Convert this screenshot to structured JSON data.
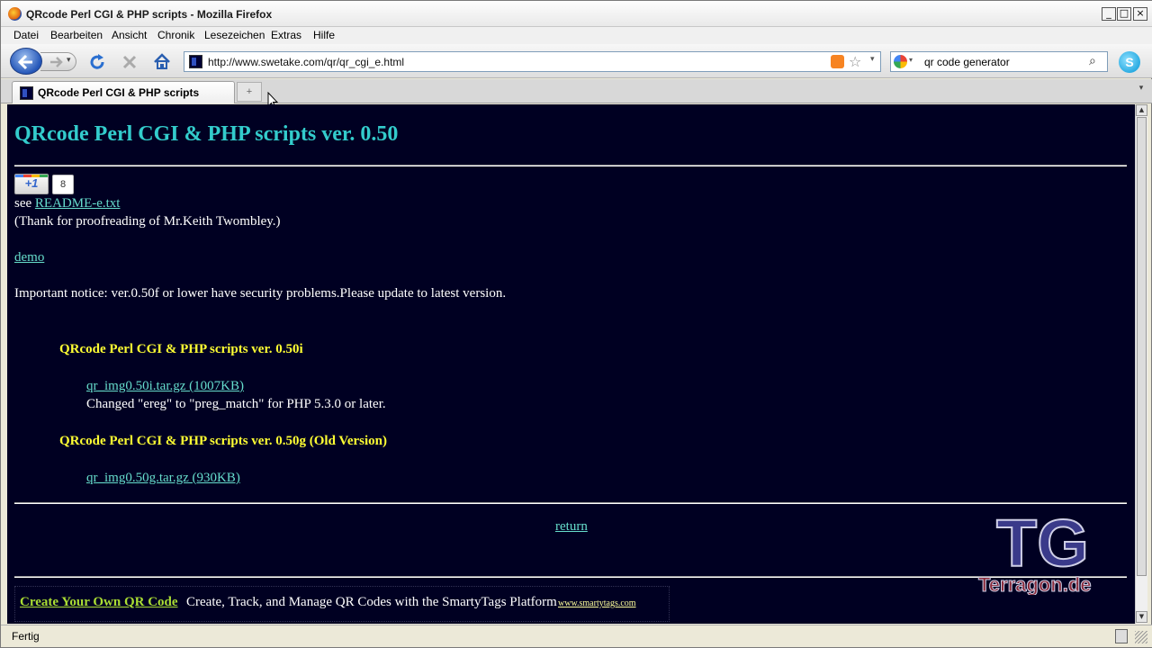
{
  "window": {
    "title": "QRcode Perl CGI & PHP scripts - Mozilla Firefox",
    "minimize": "_",
    "maximize": "□",
    "close": "×"
  },
  "menu": [
    "Datei",
    "Bearbeiten",
    "Ansicht",
    "Chronik",
    "Lesezeichen",
    "Extras",
    "Hilfe"
  ],
  "nav": {
    "url": "http://www.swetake.com/qr/qr_cgi_e.html",
    "search_value": "qr code generator",
    "url_dropdown": "▾",
    "search_dropdown": "▾",
    "search_glyph": "⌕",
    "star_glyph": "☆",
    "skype_glyph": "S"
  },
  "tabs": [
    {
      "label": "QRcode Perl CGI & PHP scripts",
      "active": true
    }
  ],
  "tabs_extra": {
    "new_tab": "+",
    "list": "▾"
  },
  "page": {
    "title": "QRcode Perl CGI & PHP scripts ver. 0.50",
    "plusone_label": "+1",
    "plusone_count": "8",
    "see_prefix": "see",
    "readme_link": "README-e.txt",
    "thanks": "(Thank for proofreading of Mr.Keith Twombley.)",
    "demo_link": "demo",
    "notice": "Important notice: ver.0.50f or lower have security problems.Please update to latest version.",
    "release1_heading": "QRcode Perl CGI & PHP scripts ver. 0.50i",
    "release1_file": "qr_img0.50i.tar.gz (1007KB)",
    "release1_note": "Changed \"ereg\" to \"preg_match\" for PHP 5.3.0 or later.",
    "release2_heading": "QRcode Perl CGI & PHP scripts ver. 0.50g (Old Version)",
    "release2_file": "qr_img0.50g.tar.gz (930KB)",
    "return_link": "return",
    "ad_link": "Create Your Own QR Code",
    "ad_text": "Create, Track, and Manage QR Codes with the SmartyTags Platform",
    "ad_url": "www.smartytags.com",
    "watermark_text": "Terragon.de",
    "watermark_letters": "TG"
  },
  "scrollbar": {
    "up": "▲",
    "down": "▼"
  },
  "status": {
    "text": "Fertig"
  },
  "colors": {
    "page_bg": "#000022",
    "heading": "#33cccc",
    "subheading": "#ffff33",
    "link": "#66ddcc"
  }
}
